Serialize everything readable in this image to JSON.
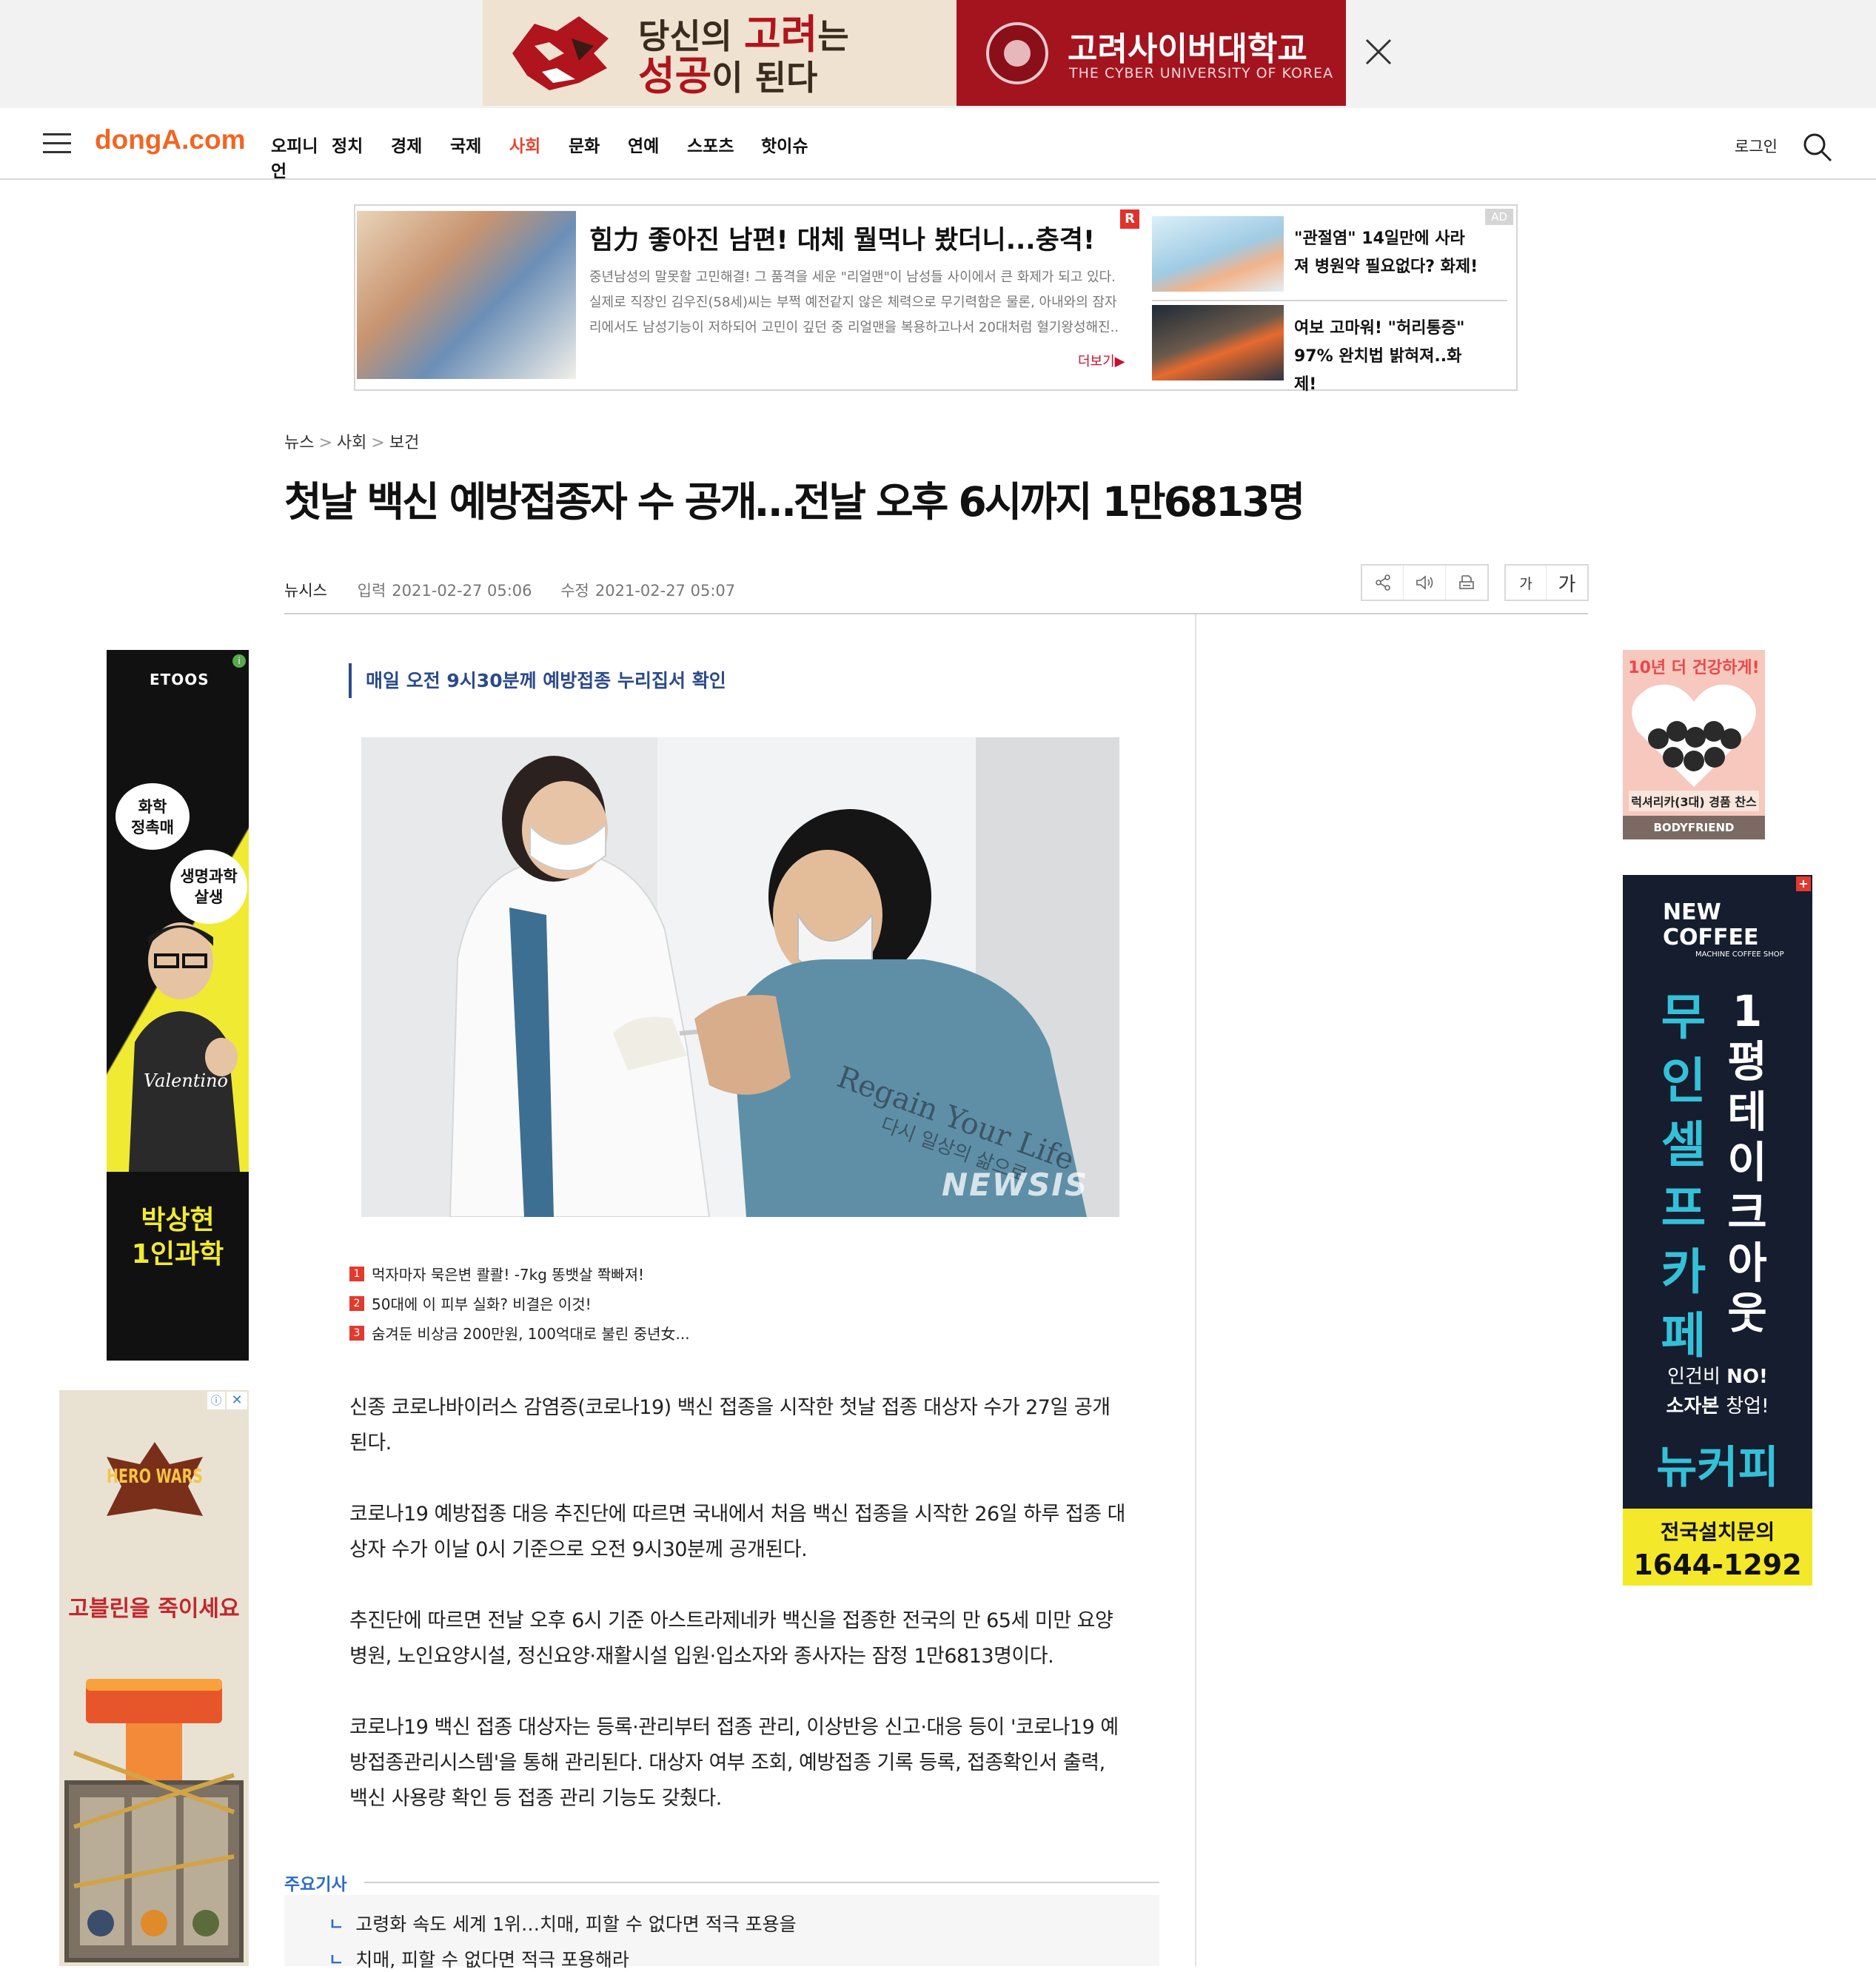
{
  "top_banner": {
    "slogan_line1_prefix": "당신의 ",
    "slogan_line1_em": "고려",
    "slogan_line1_suffix": "는",
    "slogan_line2_em": "성공",
    "slogan_line2_suffix": "이 된다",
    "university_name": "고려사이버대학교",
    "university_en": "THE CYBER UNIVERSITY OF KOREA"
  },
  "header": {
    "logo": "dongA.com",
    "nav": [
      "오피니언",
      "정치",
      "경제",
      "국제",
      "사회",
      "문화",
      "연예",
      "스포츠",
      "핫이슈"
    ],
    "active_nav": "사회",
    "login": "로그인"
  },
  "ad_box": {
    "badge_r": "R",
    "badge_ad": "AD",
    "title": "힘力 좋아진 남편! 대체 뭘먹나 봤더니...충격!",
    "body": "중년남성의 말못할 고민해결! 그 품격을 세운 \"리얼맨\"이 남성들 사이에서 큰 화제가 되고 있다. 실제로 직장인 김우진(58세)씨는 부쩍 예전같지 않은 체력으로 무기력함은 물론, 아내와의 잠자리에서도 남성기능이 저하되어 고민이 깊던 중 리얼맨을 복용하고나서 20대처럼 혈기왕성해진..",
    "more": "더보기▶",
    "sub1": "\"관절염\" 14일만에 사라져 병원약 필요없다? 화제!",
    "sub2": "여보 고마워! \"허리통증\" 97% 완치법 밝혀져..화제!"
  },
  "breadcrumb": [
    "뉴스",
    "사회",
    "보건"
  ],
  "article": {
    "title": "첫날 백신 예방접종자 수 공개…전날 오후 6시까지 1만6813명",
    "source": "뉴시스",
    "input_label": "입력",
    "input_time": "2021-02-27 05:06",
    "modify_label": "수정",
    "modify_time": "2021-02-27 05:07",
    "font_small": "가",
    "font_large": "가",
    "subtitle": "매일 오전 9시30분께 예방접종 누리집서 확인",
    "photo_watermark": "NEWSIS",
    "photo_shirt_text1": "Regain Your Life",
    "photo_shirt_text2": "다시 일상의 삶으로",
    "recommended": [
      {
        "num": "1",
        "text": "먹자마자 묵은변 콸콸! -7kg 똥뱃살 쫙빠져!"
      },
      {
        "num": "2",
        "text": "50대에 이 피부 실화? 비결은 이것!"
      },
      {
        "num": "3",
        "text": "숨겨둔 비상금 200만원, 100억대로 불린 중년女..."
      }
    ],
    "paragraphs": [
      "신종 코로나바이러스 감염증(코로나19) 백신 접종을 시작한 첫날 접종 대상자 수가 27일 공개된다.",
      "코로나19 예방접종 대응 추진단에 따르면 국내에서 처음 백신 접종을 시작한 26일 하루 접종 대상자 수가 이날 0시 기준으로 오전 9시30분께 공개된다.",
      "추진단에 따르면 전날 오후 6시 기준 아스트라제네카 백신을 접종한 전국의 만 65세 미만 요양병원, 노인요양시설, 정신요양·재활시설 입원·입소자와 종사자는 잠정 1만6813명이다.",
      "코로나19 백신 접종 대상자는 등록·관리부터 접종 관리, 이상반응 신고·대응 등이 '코로나19 예방접종관리시스템'을 통해 관리된다. 대상자 여부 조회, 예방접종 기록 등록, 접종확인서 출력, 백신 사용량 확인 등 접종 관리 기능도 갖췄다."
    ]
  },
  "main_articles": {
    "label": "주요기사",
    "arrow": "ㄴ",
    "items": [
      "고령화 속도 세계 1위…치매, 피할 수 없다면 적극 포용을",
      "치매, 피할 수 없다면 적극 포용해라"
    ]
  },
  "left_ad1": {
    "brand": "ETOOS",
    "bubble1": "화학\n정촉매",
    "bubble2": "생명과학\n살생",
    "shirt": "Valentino",
    "name": "박상현\n1인과학",
    "info": "i"
  },
  "left_ad2": {
    "logo": "HERO WARS",
    "text": "고블린을 죽이세요",
    "close": "✕",
    "info": "ⓘ"
  },
  "right_ad1": {
    "head": "10년 더 건강하게!",
    "tag": "럭셔리카(3대) 경품 찬스",
    "brand": "BODYFRIEND"
  },
  "right_ad2": {
    "plus": "+",
    "logo": "NEW COFFEE",
    "logo_small": "MACHINE COFFEE SHOP",
    "col1": [
      "무",
      "인",
      "셀",
      "프",
      "카",
      "페"
    ],
    "col2": [
      "1",
      "평",
      "테",
      "이",
      "크",
      "아",
      "웃"
    ],
    "sub_line1_a": "인건비 ",
    "sub_line1_b": "NO!",
    "sub_line2_a": "소자본 ",
    "sub_line2_b": "창업!",
    "brand": "뉴커피",
    "foot_line1": "전국설치문의",
    "foot_line2": "1644-1292"
  },
  "colors": {
    "brand": "#f26522",
    "active_nav": "#e8442e",
    "subtitle": "#2c4a8a",
    "link_blue": "#2c6cc9"
  }
}
